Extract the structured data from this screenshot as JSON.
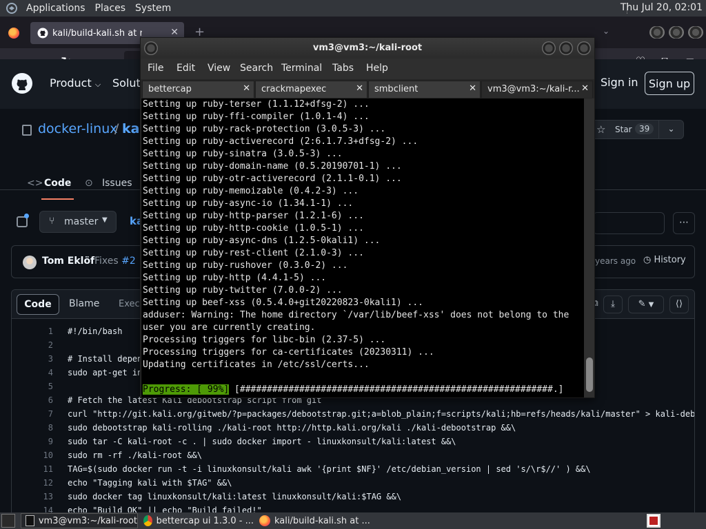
{
  "system_panel": {
    "menus": [
      "Applications",
      "Places",
      "System"
    ],
    "clock": "Thu Jul 20, 02:01"
  },
  "browser": {
    "tab_title": "kali/build-kali.sh at master",
    "icons": [
      "back-arrow-icon",
      "forward-arrow-icon",
      "reload-icon",
      "pocket-icon",
      "extensions-icon",
      "menu-hamburger-icon"
    ]
  },
  "github": {
    "header": {
      "product": "Product",
      "solutions": "Soluti",
      "sign_in": "Sign in",
      "sign_up": "Sign up"
    },
    "repo": {
      "owner": "docker-linux",
      "slash": "/",
      "name": "kali",
      "star_label": "Star",
      "star_count": "39",
      "tabs": [
        "Code",
        "Issues"
      ]
    },
    "file_bar": {
      "branch": "master",
      "crumb": "ka"
    },
    "commit": {
      "author": "Tom Eklöf",
      "message": "Fixes",
      "issue_link": "#2",
      "ago": "years ago",
      "history": "History"
    },
    "code_toolbar": {
      "code": "Code",
      "blame": "Blame",
      "exec": "Execu"
    },
    "code_lines": [
      {
        "n": "1",
        "text": "#!/bin/bash",
        "cls": "tk-cm"
      },
      {
        "n": "2",
        "text": "",
        "cls": ""
      },
      {
        "n": "3",
        "text": "# Install depen",
        "cls": "tk-cm"
      },
      {
        "n": "4",
        "text": "sudo apt-get in",
        "cls": ""
      },
      {
        "n": "5",
        "text": "",
        "cls": ""
      },
      {
        "n": "6",
        "text": "# Fetch the latest Kali debootstrap script from git",
        "cls": "tk-cm"
      },
      {
        "n": "7",
        "text": "curl \"http://git.kali.org/gitweb/?p=packages/debootstrap.git;a=blob_plain;f=scripts/kali;hb=refs/heads/kali/master\" > kali-debo",
        "cls": ""
      },
      {
        "n": "8",
        "text": "sudo debootstrap kali-rolling ./kali-root http://http.kali.org/kali ./kali-debootstrap &&\\",
        "cls": ""
      },
      {
        "n": "9",
        "text": "sudo tar -C kali-root -c . | sudo docker import - linuxkonsult/kali:latest &&\\",
        "cls": ""
      },
      {
        "n": "10",
        "text": "sudo rm -rf ./kali-root &&\\",
        "cls": ""
      },
      {
        "n": "11",
        "text": "TAG=$(sudo docker run -t -i linuxkonsult/kali awk '{print $NF}' /etc/debian_version | sed 's/\\r$//' ) &&\\",
        "cls": ""
      },
      {
        "n": "12",
        "text": "echo \"Tagging kali with $TAG\" &&\\",
        "cls": ""
      },
      {
        "n": "13",
        "text": "sudo docker tag linuxkonsult/kali:latest linuxkonsult/kali:$TAG &&\\",
        "cls": ""
      },
      {
        "n": "14",
        "text": "echo \"Build OK\" || echo \"Build failed!\"",
        "cls": ""
      }
    ]
  },
  "terminal": {
    "title": "vm3@vm3:~/kali-root",
    "menu": [
      "File",
      "Edit",
      "View",
      "Search",
      "Terminal",
      "Tabs",
      "Help"
    ],
    "tabs": [
      "bettercap",
      "crackmapexec",
      "smbclient",
      "vm3@vm3:~/kali-r..."
    ],
    "lines": [
      "Setting up ruby-terser (1.1.12+dfsg-2) ...",
      "Setting up ruby-ffi-compiler (1.0.1-4) ...",
      "Setting up ruby-rack-protection (3.0.5-3) ...",
      "Setting up ruby-activerecord (2:6.1.7.3+dfsg-2) ...",
      "Setting up ruby-sinatra (3.0.5-3) ...",
      "Setting up ruby-domain-name (0.5.20190701-1) ...",
      "Setting up ruby-otr-activerecord (2.1.1-0.1) ...",
      "Setting up ruby-memoizable (0.4.2-3) ...",
      "Setting up ruby-async-io (1.34.1-1) ...",
      "Setting up ruby-http-parser (1.2.1-6) ...",
      "Setting up ruby-http-cookie (1.0.5-1) ...",
      "Setting up ruby-async-dns (1.2.5-0kali1) ...",
      "Setting up ruby-rest-client (2.1.0-3) ...",
      "Setting up ruby-rushover (0.3.0-2) ...",
      "Setting up ruby-http (4.4.1-5) ...",
      "Setting up ruby-twitter (7.0.0-2) ...",
      "Setting up beef-xss (0.5.4.0+git20220823-0kali1) ...",
      "adduser: Warning: The home directory `/var/lib/beef-xss' does not belong to the",
      "user you are currently creating.",
      "Processing triggers for libc-bin (2.37-5) ...",
      "Processing triggers for ca-certificates (20230311) ...",
      "Updating certificates in /etc/ssl/certs..."
    ],
    "progress_label": "Progress: [ 99%]",
    "progress_bar": " [##########################################################.]",
    "progress_color": "#4e9a06"
  },
  "taskbar": {
    "items": [
      "vm3@vm3:~/kali-root",
      "bettercap ui 1.3.0 - ...",
      "kali/build-kali.sh at ..."
    ]
  }
}
